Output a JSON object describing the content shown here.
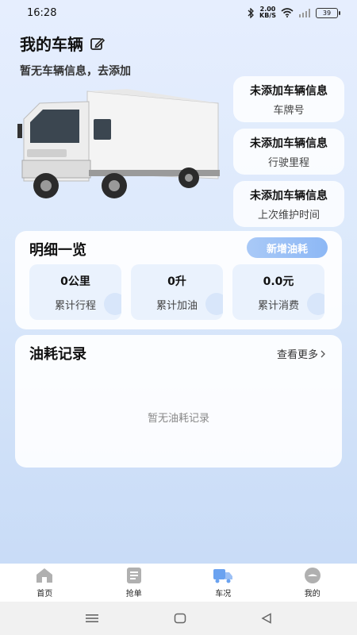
{
  "status": {
    "time": "16:28",
    "speed_value": "2.00",
    "speed_unit": "KB/S",
    "battery": "39"
  },
  "header": {
    "title": "我的车辆",
    "subtitle": "暂无车辆信息，去添加"
  },
  "vehicle_info": [
    {
      "main": "未添加车辆信息",
      "sub": "车牌号"
    },
    {
      "main": "未添加车辆信息",
      "sub": "行驶里程"
    },
    {
      "main": "未添加车辆信息",
      "sub": "上次维护时间"
    }
  ],
  "detail": {
    "title": "明细一览",
    "add_button": "新增油耗",
    "stats": [
      {
        "value": "0公里",
        "label": "累计行程"
      },
      {
        "value": "0升",
        "label": "累计加油"
      },
      {
        "value": "0.0元",
        "label": "累计消费"
      }
    ]
  },
  "records": {
    "title": "油耗记录",
    "view_more": "查看更多",
    "empty": "暂无油耗记录"
  },
  "tabs": [
    {
      "label": "首页",
      "icon": "home-icon"
    },
    {
      "label": "抢单",
      "icon": "list-icon"
    },
    {
      "label": "车况",
      "icon": "truck-icon",
      "active": true
    },
    {
      "label": "我的",
      "icon": "profile-icon"
    }
  ],
  "colors": {
    "accent": "#8db8f5",
    "active_tab": "#6aa2f0",
    "inactive_tab": "#b0b0b0"
  }
}
